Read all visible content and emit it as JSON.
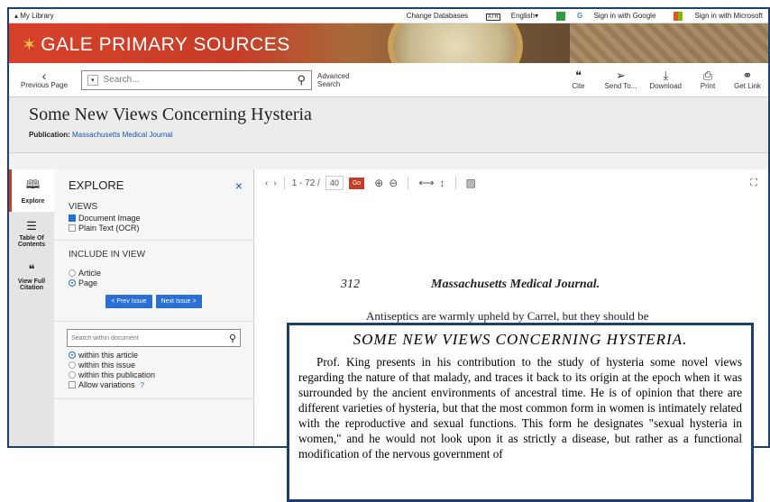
{
  "topbar": {
    "library": "▴ My Library",
    "change_db": "Change Databases",
    "language": "English",
    "lang_badge": "A͞T",
    "google": "Sign in with Google",
    "microsoft": "Sign in with Microsoft"
  },
  "banner": {
    "brand": "GALE PRIMARY SOURCES"
  },
  "toolbar": {
    "previous": "Previous Page",
    "search_placeholder": "Search...",
    "advanced": "Advanced Search",
    "tools": [
      {
        "label": "Cite",
        "icon": "cite-icon"
      },
      {
        "label": "Send To...",
        "icon": "send-icon"
      },
      {
        "label": "Download",
        "icon": "download-icon"
      },
      {
        "label": "Print",
        "icon": "print-icon"
      },
      {
        "label": "Get Link",
        "icon": "link-icon"
      }
    ]
  },
  "document": {
    "title": "Some New Views Concerning Hysteria",
    "publication_label": "Publication:",
    "publication": "Massachusetts Medical Journal"
  },
  "tabs": [
    {
      "label": "Explore",
      "icon": "book-icon"
    },
    {
      "label": "Table Of Contents",
      "icon": "list-icon"
    },
    {
      "label": "View Full Citation",
      "icon": "quote-icon"
    }
  ],
  "explore": {
    "heading": "EXPLORE",
    "close": "×",
    "views_label": "VIEWS",
    "views": [
      "Document Image",
      "Plain Text (OCR)"
    ],
    "include_label": "INCLUDE IN VIEW",
    "include": [
      "Article",
      "Page"
    ],
    "prev_issue": "< Prev Issue",
    "next_issue": "Next Issue >",
    "search_placeholder": "Search within document",
    "scope": [
      "within this article",
      "within this issue",
      "within this publication"
    ],
    "allow": "Allow variations",
    "help": "?"
  },
  "viewer": {
    "page_range": "1 - 72 /",
    "page": "40",
    "go": "Go"
  },
  "page_image": {
    "page_number": "312",
    "journal": "Massachusetts Medical Journal.",
    "line1": "Antiseptics are warmly upheld by Carrel, but they should be"
  },
  "zoom": {
    "heading": "SOME NEW VIEWS CONCERNING HYSTERIA.",
    "text": "Prof. King presents in his contribution to the study of hysteria some novel views regarding the nature of that malady, and traces it back to its origin at the epoch when it was surrounded by the ancient environments of ancestral time. He is of opinion that there are different varieties of hysteria, but that the most common form in women is intimately related with the reproductive and sexual functions. This form he designates \"sexual hysteria in women,\" and he would not look upon it as strictly a disease, but rather as a functional modification of the nervous government of"
  },
  "colors": {
    "brand_red": "#c73d27",
    "navy": "#1c3f6e",
    "link_blue": "#1a56a8"
  }
}
